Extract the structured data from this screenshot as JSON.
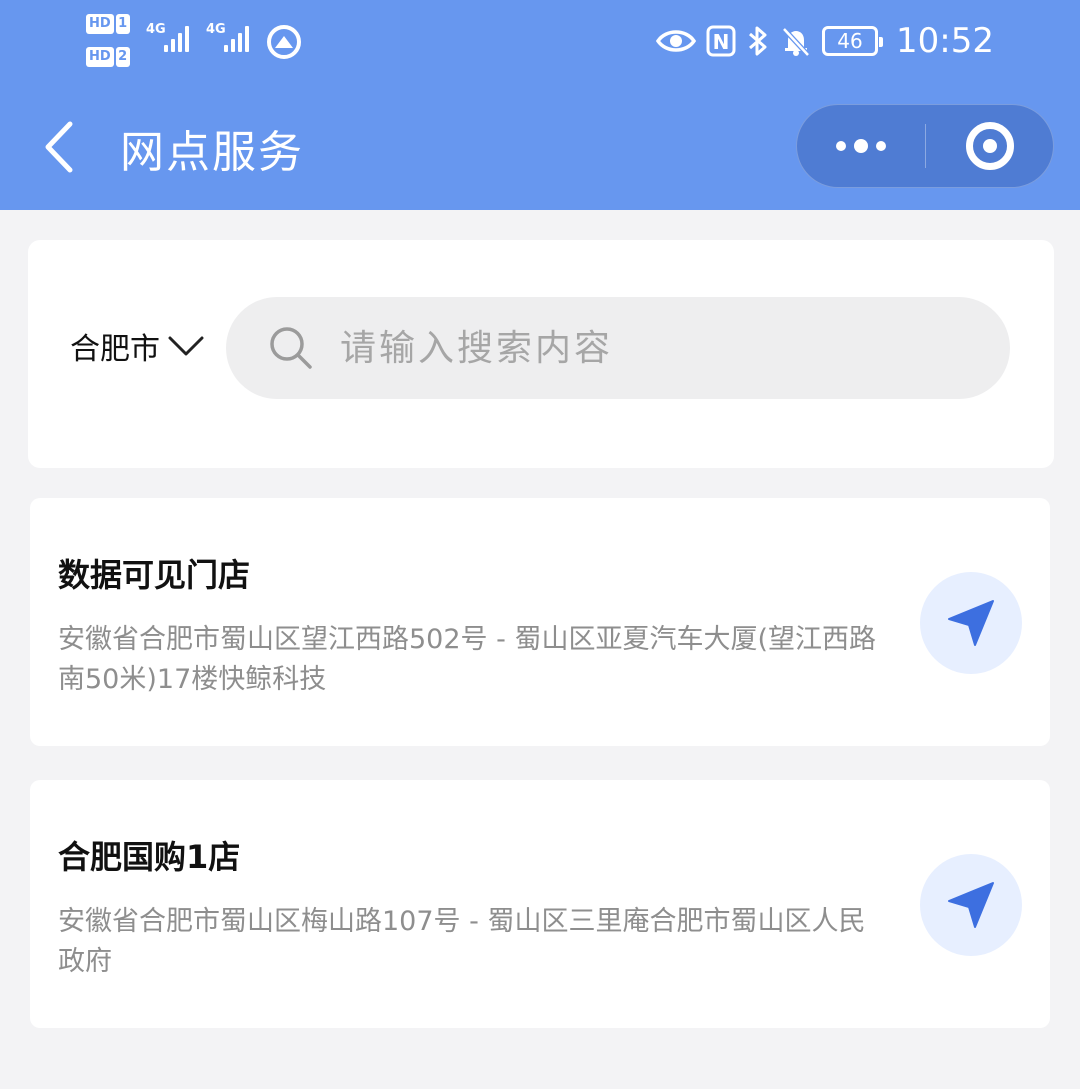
{
  "status_bar": {
    "hd1_tag": "HD",
    "hd1_num": "1",
    "hd2_tag": "HD",
    "hd2_num": "2",
    "sim1_net": "4G",
    "sim2_net": "4G",
    "nfc": "N",
    "battery": "46",
    "time": "10:52",
    "icons": [
      "eye-icon",
      "nfc-icon",
      "bluetooth-icon",
      "bell-off-icon",
      "battery-icon"
    ]
  },
  "navbar": {
    "title": "网点服务",
    "back_icon": "chevron-left-icon",
    "menu_icon": "more-dots-icon",
    "close_icon": "target-circle-icon"
  },
  "search": {
    "city": "合肥市",
    "placeholder": "请输入搜索内容",
    "value": ""
  },
  "stores": [
    {
      "name": "数据可见门店",
      "address": "安徽省合肥市蜀山区望江西路502号 - 蜀山区亚夏汽车大厦(望江西路南50米)17楼快鲸科技"
    },
    {
      "name": "合肥国购1店",
      "address": "安徽省合肥市蜀山区梅山路107号 - 蜀山区三里庵合肥市蜀山区人民政府"
    }
  ],
  "colors": {
    "header": "#6797ef",
    "capsule": "#4f7cd3",
    "nav_button_bg": "#e7efff",
    "nav_arrow": "#3d6fe0",
    "page_bg": "#f3f3f5"
  }
}
